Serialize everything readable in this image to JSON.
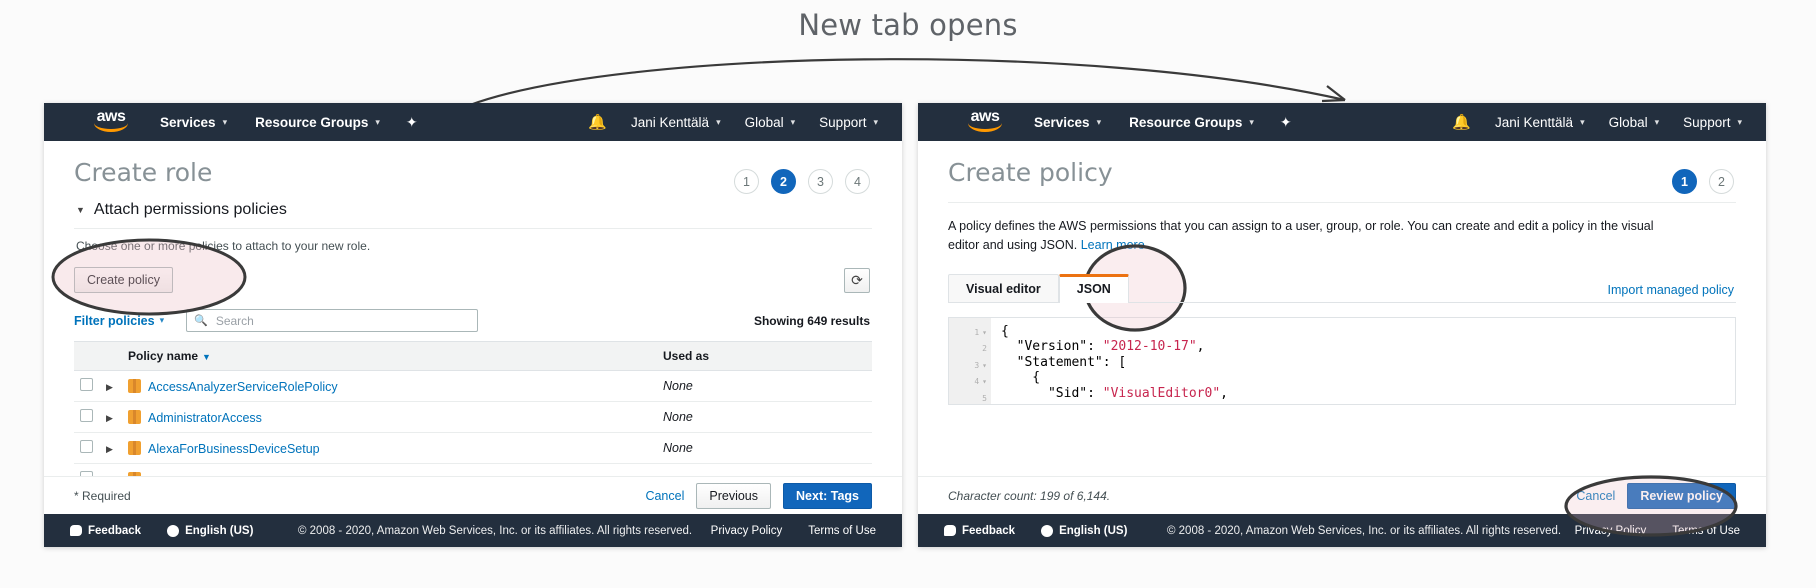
{
  "annotation": {
    "title": "New tab opens"
  },
  "topnav": {
    "logo": "aws",
    "services": "Services",
    "resource_groups": "Resource Groups",
    "pin_icon": "pin-icon",
    "bell_icon": "bell-icon",
    "user": "Jani Kenttälä",
    "region": "Global",
    "support": "Support"
  },
  "left": {
    "title": "Create role",
    "steps": [
      "1",
      "2",
      "3",
      "4"
    ],
    "active_step": 2,
    "section_heading": "Attach permissions policies",
    "help_text": "Choose one or more policies to attach to your new role.",
    "create_policy_button": "Create policy",
    "refresh_icon": "refresh-icon",
    "filter_label": "Filter policies",
    "search_placeholder": "Search",
    "search_value": "",
    "search_icon": "search-icon",
    "showing_results": "Showing 649 results",
    "table": {
      "columns": [
        "Policy name",
        "Used as"
      ],
      "rows": [
        {
          "name": "AccessAnalyzerServiceRolePolicy",
          "used_as": "None"
        },
        {
          "name": "AdministratorAccess",
          "used_as": "None"
        },
        {
          "name": "AlexaForBusinessDeviceSetup",
          "used_as": "None"
        }
      ]
    },
    "required_note": "* Required",
    "cancel": "Cancel",
    "previous": "Previous",
    "next": "Next: Tags"
  },
  "right": {
    "title": "Create policy",
    "steps": [
      "1",
      "2"
    ],
    "active_step": 1,
    "intro_text": "A policy defines the AWS permissions that you can assign to a user, group, or role. You can create and edit a policy in the visual editor and using JSON. ",
    "intro_link": "Learn more",
    "tabs": [
      {
        "label": "Visual editor",
        "selected": false
      },
      {
        "label": "JSON",
        "selected": true
      }
    ],
    "import_link": "Import managed policy",
    "editor": {
      "lines": [
        {
          "num": "1",
          "foldable": true,
          "text": "{"
        },
        {
          "num": "2",
          "foldable": false,
          "text": "  \"Version\": \"2012-10-17\","
        },
        {
          "num": "3",
          "foldable": true,
          "text": "  \"Statement\": ["
        },
        {
          "num": "4",
          "foldable": true,
          "text": "    {"
        },
        {
          "num": "5",
          "foldable": false,
          "text": "      \"Sid\": \"VisualEditor0\","
        }
      ]
    },
    "character_count": "Character count: 199 of 6,144.",
    "cancel": "Cancel",
    "review_policy": "Review policy"
  },
  "footer": {
    "feedback": "Feedback",
    "language": "English (US)",
    "copyright": "© 2008 - 2020, Amazon Web Services, Inc. or its affiliates. All rights reserved.",
    "privacy": "Privacy Policy",
    "terms": "Terms of Use"
  },
  "colors": {
    "nav_dark": "#232f3e",
    "aws_orange": "#ff9900",
    "link_blue": "#0073bb",
    "primary_blue": "#1166bb",
    "tab_orange": "#ec7211"
  }
}
